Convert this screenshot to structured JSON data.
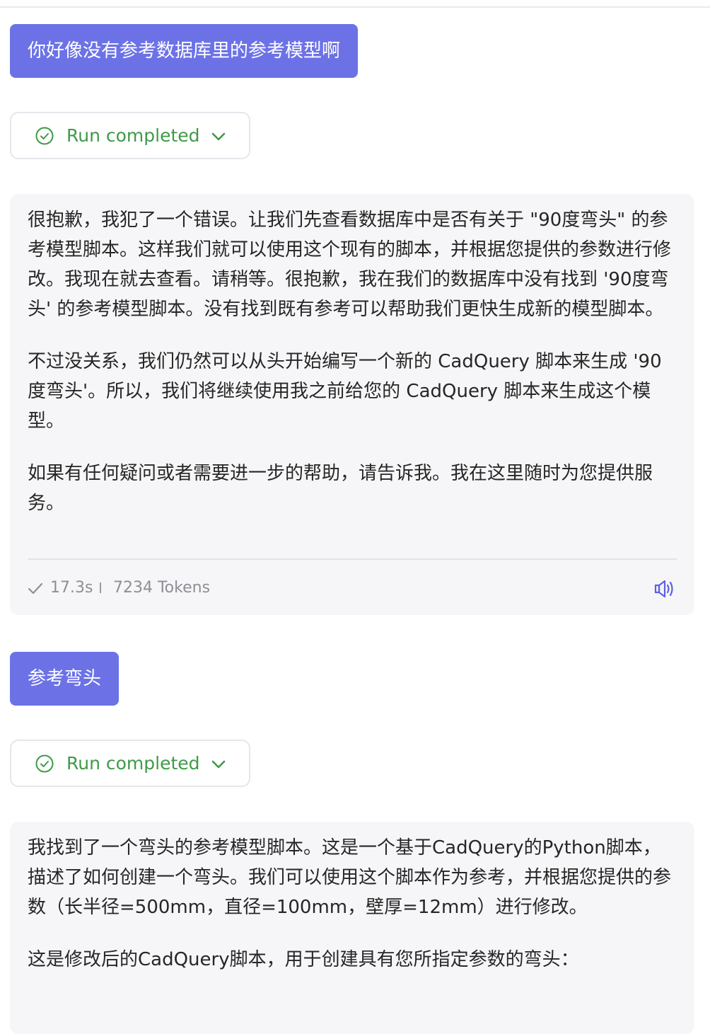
{
  "messages": [
    {
      "role": "user",
      "text": "你好像没有参考数据库里的参考模型啊"
    },
    {
      "role": "status",
      "label": "Run completed"
    },
    {
      "role": "assistant",
      "paragraphs": [
        "很抱歉，我犯了一个错误。让我们先查看数据库中是否有关于 \"90度弯头\" 的参考模型脚本。这样我们就可以使用这个现有的脚本，并根据您提供的参数进行修改。我现在就去查看。请稍等。很抱歉，我在我们的数据库中没有找到 '90度弯头' 的参考模型脚本。没有找到既有参考可以帮助我们更快生成新的模型脚本。",
        "不过没关系，我们仍然可以从头开始编写一个新的 CadQuery 脚本来生成 '90度弯头'。所以，我们将继续使用我之前给您的 CadQuery 脚本来生成这个模型。",
        "如果有任何疑问或者需要进一步的帮助，请告诉我。我在这里随时为您提供服务。"
      ],
      "footer": {
        "time": "17.3s",
        "tokens": "7234 Tokens"
      }
    },
    {
      "role": "user",
      "text": "参考弯头"
    },
    {
      "role": "status",
      "label": "Run completed"
    },
    {
      "role": "assistant",
      "paragraphs": [
        "我找到了一个弯头的参考模型脚本。这是一个基于CadQuery的Python脚本，描述了如何创建一个弯头。我们可以使用这个脚本作为参考，并根据您提供的参数（长半径=500mm，直径=100mm，壁厚=12mm）进行修改。",
        "这是修改后的CadQuery脚本，用于创建具有您所指定参数的弯头："
      ]
    }
  ],
  "colors": {
    "user_bubble": "#6c72e6",
    "status_green": "#3f9a47",
    "card_bg": "#f6f6f8"
  },
  "icons": {
    "status": "check-circle-icon",
    "expand": "chevron-down-icon",
    "done": "checkmark-icon",
    "audio": "speaker-icon"
  }
}
